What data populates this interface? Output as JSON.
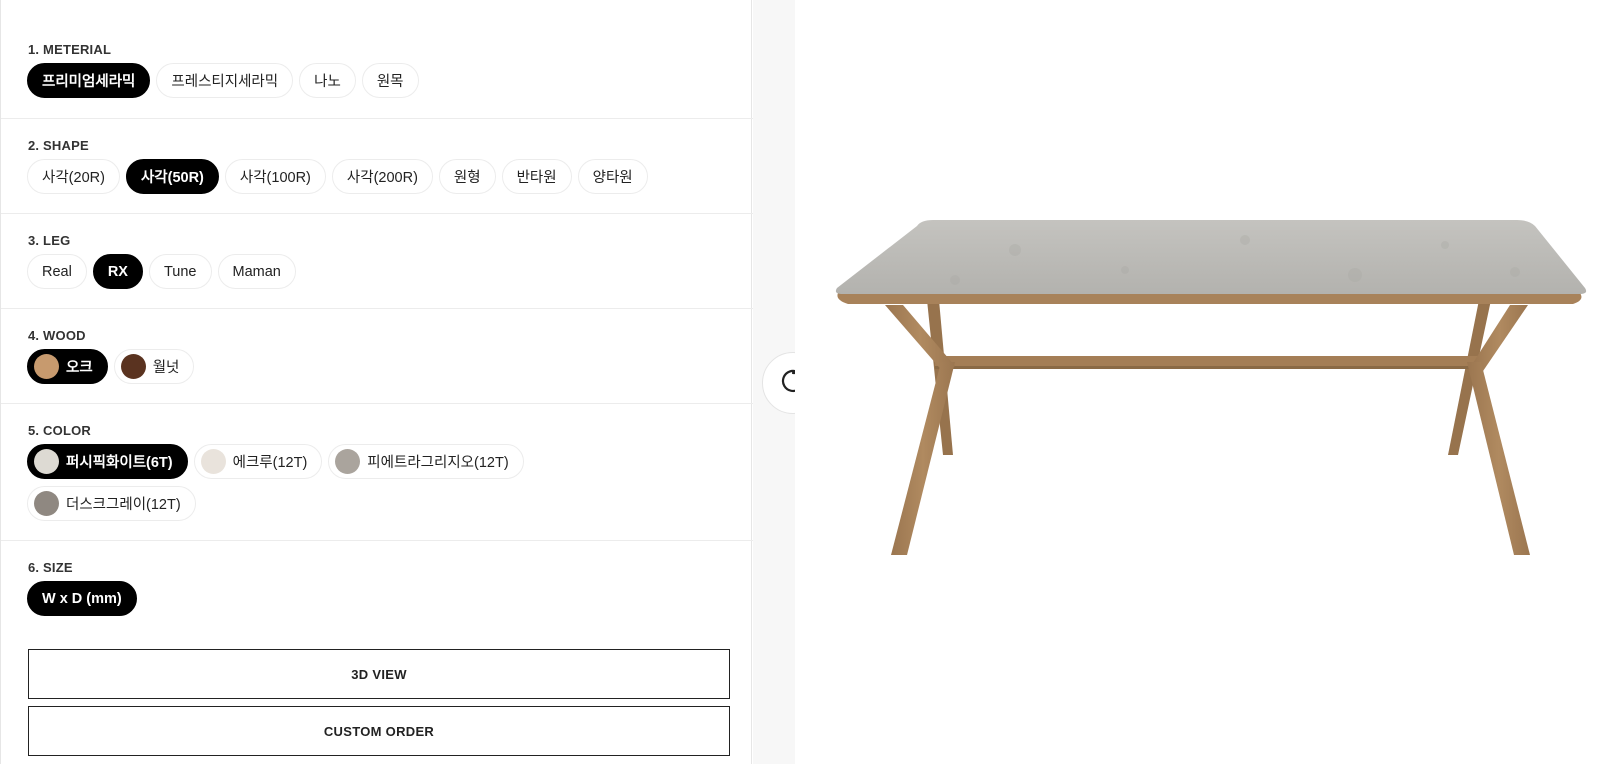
{
  "sections": [
    {
      "title": "1. METERIAL",
      "options": [
        {
          "label": "프리미엄세라믹",
          "selected": true
        },
        {
          "label": "프레스티지세라믹",
          "selected": false
        },
        {
          "label": "나노",
          "selected": false
        },
        {
          "label": "원목",
          "selected": false
        }
      ]
    },
    {
      "title": "2. SHAPE",
      "options": [
        {
          "label": "사각(20R)",
          "selected": false
        },
        {
          "label": "사각(50R)",
          "selected": true
        },
        {
          "label": "사각(100R)",
          "selected": false
        },
        {
          "label": "사각(200R)",
          "selected": false
        },
        {
          "label": "원형",
          "selected": false
        },
        {
          "label": "반타원",
          "selected": false
        },
        {
          "label": "양타원",
          "selected": false
        }
      ]
    },
    {
      "title": "3. LEG",
      "options": [
        {
          "label": "Real",
          "selected": false
        },
        {
          "label": "RX",
          "selected": true
        },
        {
          "label": "Tune",
          "selected": false
        },
        {
          "label": "Maman",
          "selected": false
        }
      ]
    },
    {
      "title": "4. WOOD",
      "options": [
        {
          "label": "오크",
          "selected": true,
          "swatch": "#c79a6e"
        },
        {
          "label": "월넛",
          "selected": false,
          "swatch": "#5a3320"
        }
      ]
    },
    {
      "title": "5. COLOR",
      "options": [
        {
          "label": "퍼시픽화이트(6T)",
          "selected": true,
          "swatch": "#dddad3"
        },
        {
          "label": "에크루(12T)",
          "selected": false,
          "swatch": "#e9e3dc"
        },
        {
          "label": "피에트라그리지오(12T)",
          "selected": false,
          "swatch": "#aaa49d"
        },
        {
          "label": "더스크그레이(12T)",
          "selected": false,
          "swatch": "#8f8881"
        }
      ]
    },
    {
      "title": "6. SIZE",
      "options": [
        {
          "label": "W x D (mm)",
          "selected": true
        }
      ]
    }
  ],
  "buttons": {
    "view_3d": "3D VIEW",
    "custom_order": "CUSTOM ORDER"
  },
  "viewer": {
    "rotate_icon": "rotate-icon",
    "product_image": "table-image",
    "tabletop_color": "#bdbcb8",
    "wood_color": "#a8825a"
  }
}
